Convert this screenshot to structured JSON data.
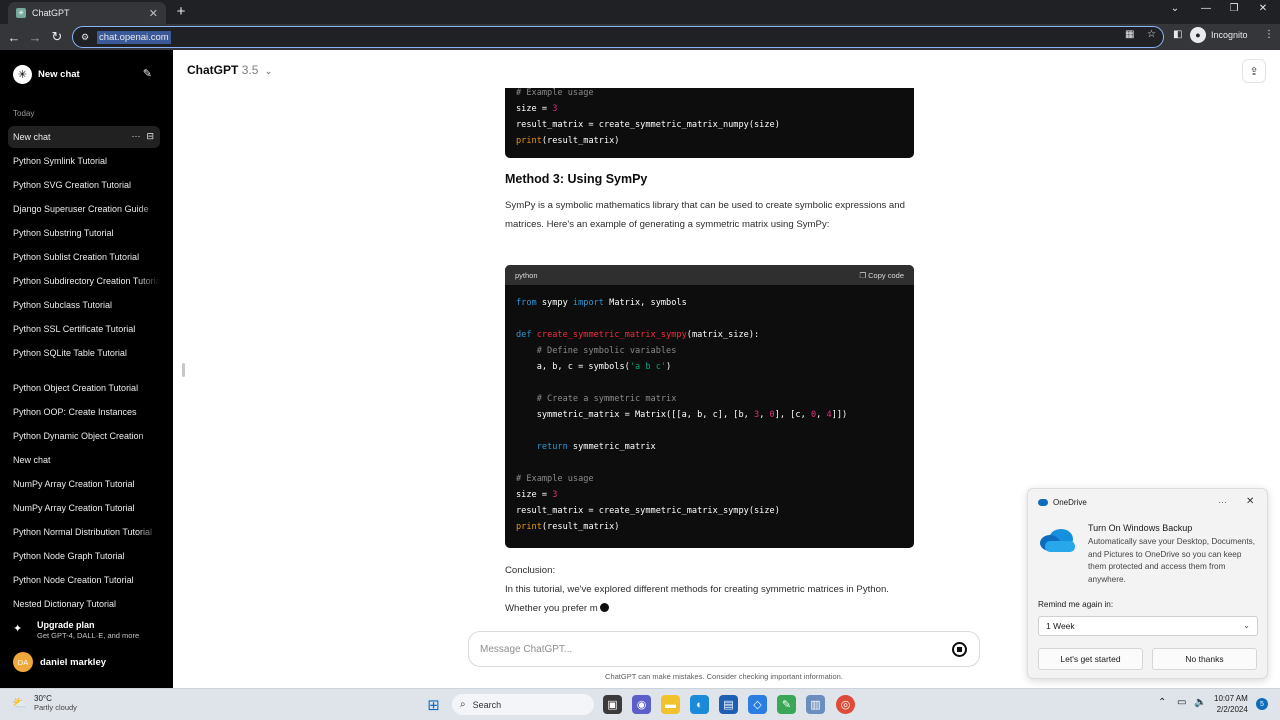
{
  "browser": {
    "tab_title": "ChatGPT",
    "url": "chat.openai.com",
    "profile_label": "Incognito"
  },
  "sidebar": {
    "new_chat_label": "New chat",
    "section_today": "Today",
    "items": [
      {
        "label": "New chat"
      },
      {
        "label": "Python Symlink Tutorial"
      },
      {
        "label": "Python SVG Creation Tutorial"
      },
      {
        "label": "Django Superuser Creation Guide"
      },
      {
        "label": "Python Substring Tutorial"
      },
      {
        "label": "Python Sublist Creation Tutorial"
      },
      {
        "label": "Python Subdirectory Creation Tutorial"
      },
      {
        "label": "Python Subclass Tutorial"
      },
      {
        "label": "Python SSL Certificate Tutorial"
      },
      {
        "label": "Python SQLite Table Tutorial"
      },
      {
        "label": "Python Object Creation Tutorial"
      },
      {
        "label": "Python OOP: Create Instances"
      },
      {
        "label": "Python Dynamic Object Creation"
      },
      {
        "label": "New chat"
      },
      {
        "label": "NumPy Array Creation Tutorial"
      },
      {
        "label": "NumPy Array Creation Tutorial"
      },
      {
        "label": "Python Normal Distribution Tutorial"
      },
      {
        "label": "Python Node Graph Tutorial"
      },
      {
        "label": "Python Node Creation Tutorial"
      },
      {
        "label": "Nested Dictionary Tutorial"
      }
    ],
    "upgrade_title": "Upgrade plan",
    "upgrade_subtitle": "Get GPT-4, DALL·E, and more",
    "user_initials": "DA",
    "user_name": "daniel markley"
  },
  "main": {
    "model_name": "ChatGPT",
    "model_version": "3.5",
    "heading": "Method 3: Using SymPy",
    "intro_paragraph": "SymPy is a symbolic mathematics library that can be used to create symbolic expressions and matrices. Here's an example of generating a symmetric matrix using SymPy:",
    "code_language": "python",
    "copy_label": "Copy code",
    "conclusion_label": "Conclusion:",
    "conclusion_text": "In this tutorial, we've explored different methods for creating symmetric matrices in Python. Whether you prefer m",
    "composer_placeholder": "Message ChatGPT...",
    "disclaimer": "ChatGPT can make mistakes. Consider checking important information."
  },
  "toast": {
    "app_name": "OneDrive",
    "title": "Turn On Windows Backup",
    "body": "Automatically save your Desktop, Documents, and Pictures to OneDrive so you can keep them protected and access them from anywhere.",
    "remind_label": "Remind me again in:",
    "remind_value": "1 Week",
    "primary_button": "Let's get started",
    "secondary_button": "No thanks"
  },
  "taskbar": {
    "temperature": "30°C",
    "weather": "Partly cloudy",
    "search_label": "Search",
    "time": "10:07 AM",
    "date": "2/2/2024",
    "notification_count": "5"
  },
  "colors": {
    "sidebar_bg": "#000000",
    "code_bg": "#0d0d0d",
    "code_keyword": "#2e95d3",
    "code_function": "#f22c3d",
    "code_string": "#00a67d",
    "code_number": "#df3079",
    "code_comment": "#8a8a8a"
  }
}
